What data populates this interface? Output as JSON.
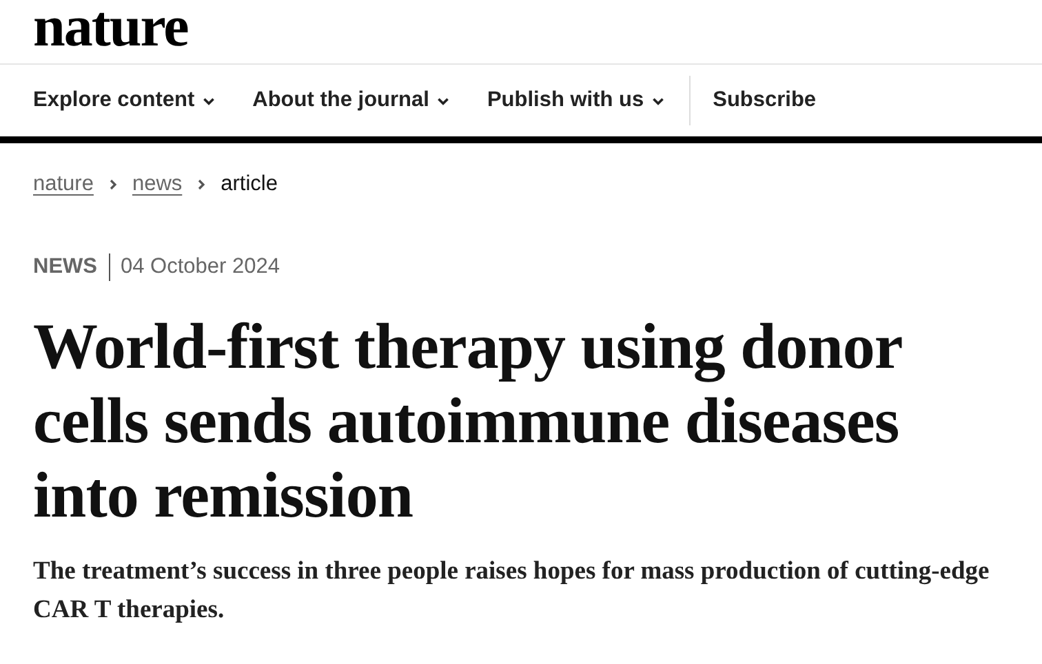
{
  "logo": "nature",
  "nav": [
    {
      "label": "Explore content",
      "dropdown": true
    },
    {
      "label": "About the journal",
      "dropdown": true
    },
    {
      "label": "Publish with us",
      "dropdown": true
    },
    {
      "label": "Subscribe",
      "dropdown": false
    }
  ],
  "breadcrumb": [
    {
      "label": "nature",
      "kind": "link"
    },
    {
      "label": "news",
      "kind": "link"
    },
    {
      "label": "article",
      "kind": "current"
    }
  ],
  "article": {
    "type": "NEWS",
    "date": "04 October 2024",
    "title": "World-first therapy using donor cells sends autoimmune diseases into remission",
    "standfirst": "The treatment’s success in three people raises hopes for mass production of cutting-edge CAR T therapies."
  }
}
